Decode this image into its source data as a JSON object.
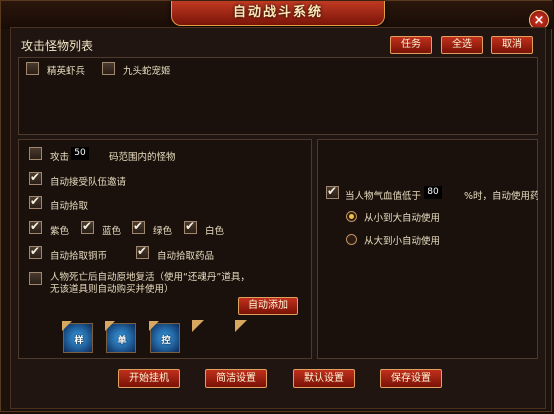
{
  "window": {
    "title": "自动战斗系统",
    "close_label": "×"
  },
  "monster_list": {
    "title": "攻击怪物列表",
    "buttons": {
      "task": "任务",
      "select_all": "全选",
      "cancel": "取消"
    },
    "items": [
      {
        "label": "精英虾兵",
        "checked": false
      },
      {
        "label": "九头蛇宠姬",
        "checked": false
      }
    ]
  },
  "left_panel": {
    "attack_prefix": "攻击",
    "attack_range": "50",
    "attack_suffix": "码范围内的怪物",
    "auto_accept_team": "自动接受队伍邀请",
    "auto_pickup": "自动拾取",
    "colors": {
      "purple": "紫色",
      "blue": "蓝色",
      "green": "绿色",
      "white": "白色"
    },
    "auto_pickup_coins": "自动拾取铜币",
    "auto_pickup_potions": "自动拾取药品",
    "revive_text_line1": "人物死亡后自动原地复活（使用“还魂丹”道具，",
    "revive_text_line2": "无该道具则自动购买并使用）",
    "auto_add_button": "自动添加",
    "skills": [
      {
        "name": "skill-1",
        "glyph": "样"
      },
      {
        "name": "skill-2",
        "glyph": "单"
      },
      {
        "name": "skill-3",
        "glyph": "控"
      }
    ]
  },
  "right_panel": {
    "hp_prefix": "当人物气血值低于",
    "hp_value": "80",
    "hp_suffix": "%时，自动使用药",
    "order_small_to_large": "从小到大自动使用",
    "order_large_to_small": "从大到小自动使用",
    "selected_order": "small_to_large"
  },
  "footer": {
    "start": "开始挂机",
    "simple": "简洁设置",
    "default": "默认设置",
    "save": "保存设置"
  },
  "colors": {
    "accent_red": "#c0301c",
    "gold_border": "#e0a060"
  }
}
